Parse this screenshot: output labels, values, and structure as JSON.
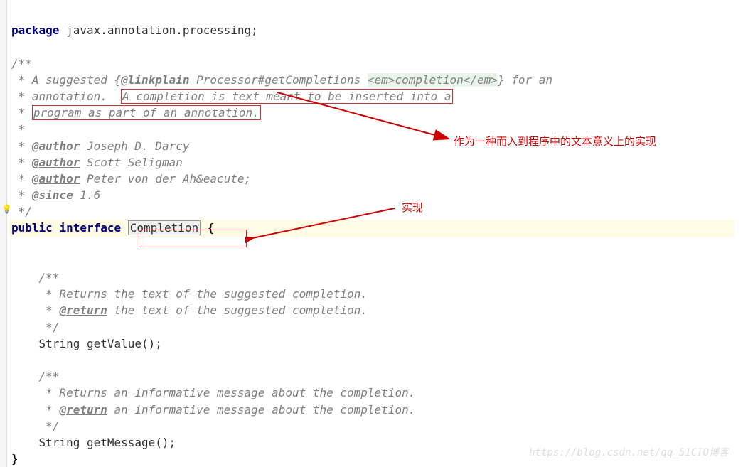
{
  "code": {
    "package_kw": "package",
    "package_name": " javax.annotation.processing;",
    "doc_open": "/**",
    "doc_l1_a": " * A suggested {",
    "doc_l1_tag": "@linkplain",
    "doc_l1_b": " Processor#getCompletions ",
    "doc_l1_c": "<em>",
    "doc_l1_em": "completion",
    "doc_l1_d": "</em>",
    "doc_l1_e": "} for an",
    "doc_l2_a": " * annotation.  ",
    "doc_l2_box": "A completion is text meant to be inserted into a",
    "doc_l3_a": " * ",
    "doc_l3_box": "program as part of an annotation.",
    "doc_star": " *",
    "doc_author": "@author",
    "doc_a1": " Joseph D. Darcy",
    "doc_a2": " Scott Seligman",
    "doc_a3": " Peter von der Ah&eacute;",
    "doc_since": "@since",
    "doc_since_v": " 1.6",
    "doc_close": " */",
    "public_kw": "public",
    "interface_kw": "interface",
    "interface_name": "Completion",
    "brace_open": " {",
    "m1_open": "    /**",
    "m1_l1": "     * Returns the text of the suggested completion.",
    "m1_ret": "     * ",
    "return_tag": "@return",
    "m1_ret_txt": " the text of the suggested completion.",
    "m1_close": "     */",
    "m1_sig": "    String getValue();",
    "m2_open": "    /**",
    "m2_l1": "     * Returns an informative message about the completion.",
    "m2_ret": "     * ",
    "m2_ret_txt": " an informative message about the completion.",
    "m2_close": "     */",
    "m2_sig": "    String getMessage();",
    "brace_close": "}"
  },
  "annotations": {
    "a1": "作为一种而入到程序中的文本意义上的实现",
    "a2": "实现"
  },
  "watermark": "https://blog.csdn.net/qq_51CTO博客",
  "bulb": "💡"
}
